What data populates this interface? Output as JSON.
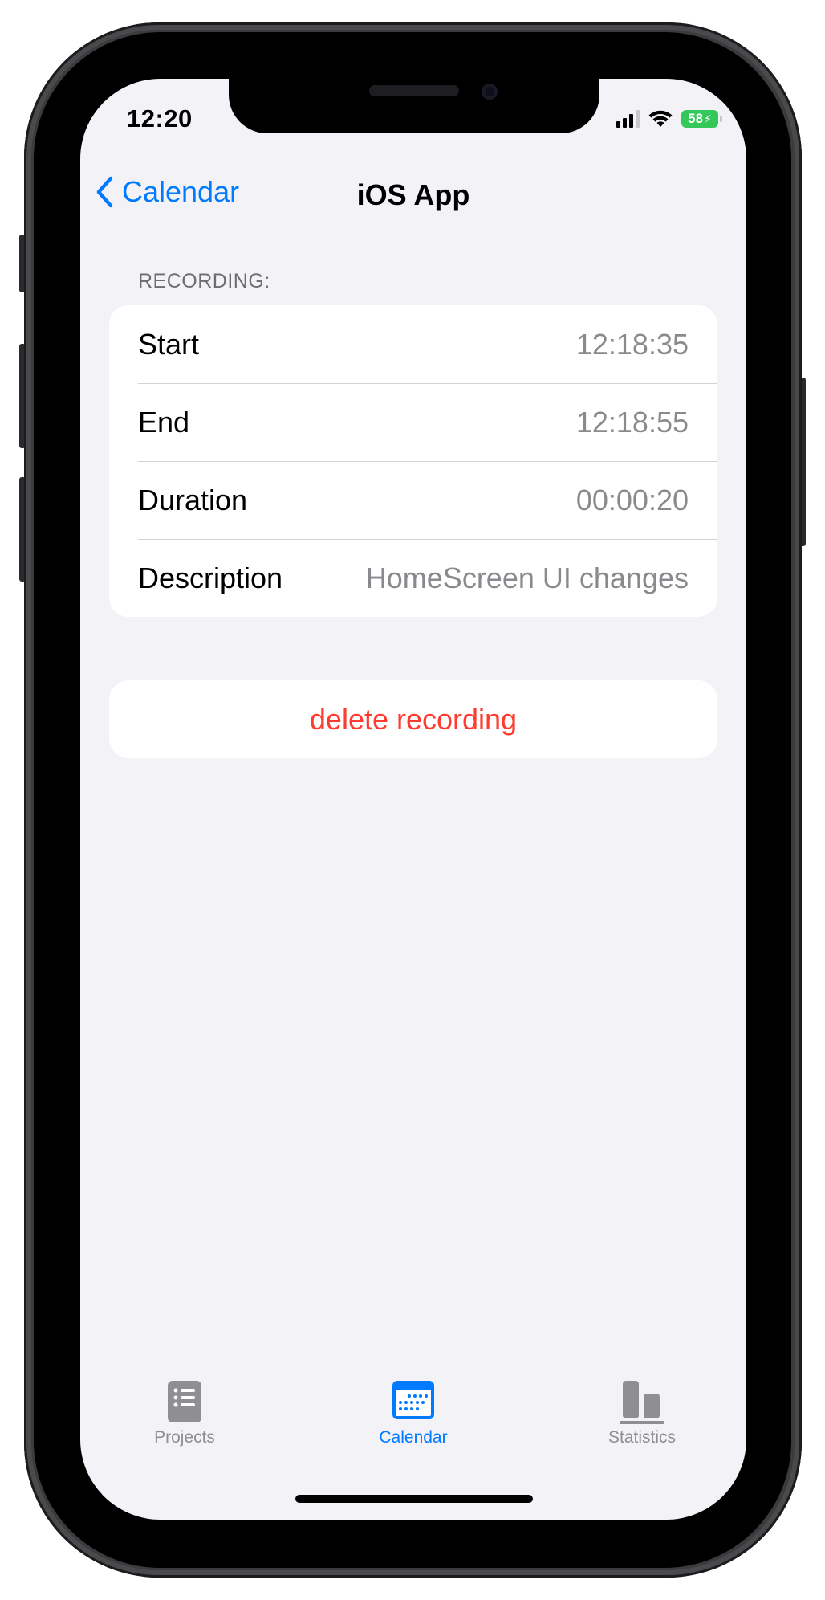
{
  "status_bar": {
    "time": "12:20",
    "battery": "58",
    "icons": [
      "cellular-signal-icon",
      "wifi-icon",
      "battery-charging-icon"
    ]
  },
  "nav": {
    "back_label": "Calendar",
    "back_icon": "chevron-left-icon",
    "title": "iOS App"
  },
  "recording": {
    "section_header": "RECORDING:",
    "rows": [
      {
        "label": "Start",
        "value": "12:18:35"
      },
      {
        "label": "End",
        "value": "12:18:55"
      },
      {
        "label": "Duration",
        "value": "00:00:20"
      },
      {
        "label": "Description",
        "value": "HomeScreen UI changes"
      }
    ],
    "delete_label": "delete recording"
  },
  "tab_bar": {
    "tabs": [
      {
        "label": "Projects",
        "icon": "list-doc-icon",
        "selected": false
      },
      {
        "label": "Calendar",
        "icon": "calendar-icon",
        "selected": true
      },
      {
        "label": "Statistics",
        "icon": "bar-chart-icon",
        "selected": false
      }
    ]
  },
  "colors": {
    "accent": "#007aff",
    "destructive": "#ff3b30",
    "background": "#f2f2f7",
    "secondary_text": "#8a8a8e",
    "tab_inactive": "#8e8e93",
    "battery": "#34c759"
  }
}
